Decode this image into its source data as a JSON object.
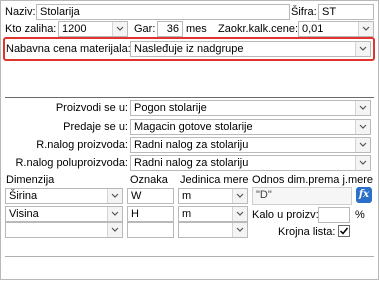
{
  "header": {
    "naziv_label": "Naziv:",
    "naziv_value": "Stolarija",
    "sifra_label": "Šifra:",
    "sifra_value": "ST",
    "kto_label": "Kto zaliha:",
    "kto_value": "1200",
    "gar_label": "Gar:",
    "gar_value": "36",
    "gar_unit": "mes",
    "zaokr_label": "Zaokr.kalk.cene:",
    "zaokr_value": "0,01",
    "nabavna_label": "Nabavna cena materijala:",
    "nabavna_value": "Nasleđuje iz nadgrupe"
  },
  "assignments": [
    {
      "label": "Proizvodi se u:",
      "value": "Pogon stolarije"
    },
    {
      "label": "Predaje se u:",
      "value": "Magacin gotove stolarije"
    },
    {
      "label": "R.nalog proizvoda:",
      "value": "Radni nalog za stolariju"
    },
    {
      "label": "R.nalog poluproizvoda:",
      "value": "Radni nalog za stolariju"
    }
  ],
  "dimensions": {
    "headers": {
      "dimenzija": "Dimenzija",
      "oznaka": "Oznaka",
      "jedinica": "Jedinica mere",
      "odnos": "Odnos dim.prema j.mere"
    },
    "rows": [
      {
        "dimenzija": "Širina",
        "oznaka": "W",
        "jedinica": "m"
      },
      {
        "dimenzija": "Visina",
        "oznaka": "H",
        "jedinica": "m"
      },
      {
        "dimenzija": "",
        "oznaka": "",
        "jedinica": ""
      }
    ],
    "odnos_value": "\"D\"",
    "fx_icon": "fx",
    "kalo_label": "Kalo u proizv:",
    "kalo_value": "",
    "kalo_unit": "%",
    "krojna_label": "Krojna lista:",
    "krojna_checked": true
  },
  "colors": {
    "highlight": "#e0342e",
    "fx_button": "#2b6fc9"
  }
}
